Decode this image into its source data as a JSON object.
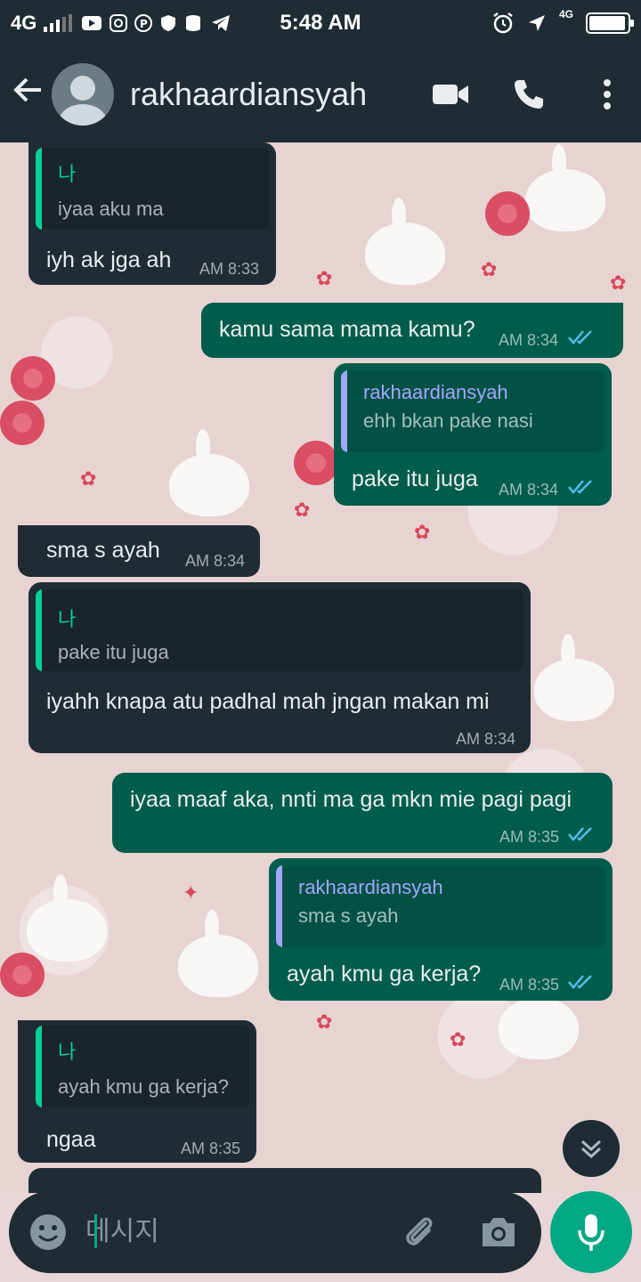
{
  "status_bar": {
    "network_left": "4G",
    "time": "5:48 AM",
    "network_right": "4G",
    "battery_level": 0.95,
    "icons": [
      "signal-icon",
      "youtube-icon",
      "instagram-icon",
      "pinterest-icon",
      "shield-icon",
      "storage-icon",
      "telegram-icon",
      "alarm-icon",
      "location-icon",
      "battery-icon"
    ]
  },
  "header": {
    "contact_name": "rakhaardiansyah",
    "icons": [
      "back-arrow-icon",
      "avatar",
      "video-call-icon",
      "phone-icon",
      "more-vert-icon"
    ]
  },
  "messages": [
    {
      "direction": "in",
      "quote_author": "나",
      "quote_text": "iyaa aku ma",
      "text": "iyh ak jga ah",
      "time": "AM 8:33"
    },
    {
      "direction": "out",
      "text": "kamu sama mama kamu?",
      "time": "AM 8:34",
      "status": "read"
    },
    {
      "direction": "out",
      "quote_author": "rakhaardiansyah",
      "quote_text": "ehh bkan pake nasi",
      "text": "pake itu juga",
      "time": "AM 8:34",
      "status": "read"
    },
    {
      "direction": "in",
      "text": "sma s ayah",
      "time": "AM 8:34"
    },
    {
      "direction": "in",
      "quote_author": "나",
      "quote_text": "pake itu juga",
      "text": "iyahh knapa atu padhal mah jngan makan mi",
      "time": "AM 8:34"
    },
    {
      "direction": "out",
      "text": "iyaa maaf aka, nnti ma ga mkn mie pagi pagi",
      "time": "AM 8:35",
      "status": "read"
    },
    {
      "direction": "out",
      "quote_author": "rakhaardiansyah",
      "quote_text": "sma s ayah",
      "text": "ayah kmu ga kerja?",
      "time": "AM 8:35",
      "status": "read"
    },
    {
      "direction": "in",
      "quote_author": "나",
      "quote_text": "ayah kmu ga kerja?",
      "text": "ngaa",
      "time": "AM 8:35"
    }
  ],
  "input": {
    "placeholder": "메시지",
    "value": ""
  },
  "colors": {
    "bar_bg": "#1f2c34",
    "incoming_bubble": "#1f2c34",
    "outgoing_bubble": "#005c4b",
    "accent": "#00a884",
    "quote_self": "#06cf9c",
    "quote_other": "#a5a5ff",
    "read_ticks": "#53bdeb"
  }
}
